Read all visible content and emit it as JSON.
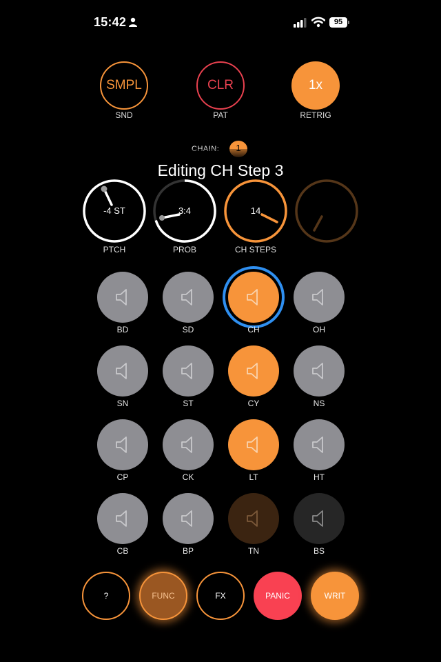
{
  "status_bar": {
    "time": "15:42",
    "battery": "95"
  },
  "top_buttons": [
    {
      "label": "SMPL",
      "caption": "SND"
    },
    {
      "label": "CLR",
      "caption": "PAT"
    },
    {
      "label": "1x",
      "caption": "RETRIG"
    }
  ],
  "chain": {
    "label": "CHAIN:",
    "value": "1"
  },
  "editing_title": "Editing CH Step 3",
  "knobs": [
    {
      "value": "-4 ST",
      "label": "PTCH"
    },
    {
      "value": "3:4",
      "label": "PROB"
    },
    {
      "value": "14",
      "label": "CH STEPS"
    },
    {
      "value": "",
      "label": ""
    }
  ],
  "pads": [
    {
      "label": "BD",
      "state": "gray"
    },
    {
      "label": "SD",
      "state": "gray"
    },
    {
      "label": "CH",
      "state": "orange-selected"
    },
    {
      "label": "OH",
      "state": "gray"
    },
    {
      "label": "SN",
      "state": "gray"
    },
    {
      "label": "ST",
      "state": "gray"
    },
    {
      "label": "CY",
      "state": "orange"
    },
    {
      "label": "NS",
      "state": "gray"
    },
    {
      "label": "CP",
      "state": "gray"
    },
    {
      "label": "CK",
      "state": "gray"
    },
    {
      "label": "LT",
      "state": "orange"
    },
    {
      "label": "HT",
      "state": "gray"
    },
    {
      "label": "CB",
      "state": "gray"
    },
    {
      "label": "BP",
      "state": "gray"
    },
    {
      "label": "TN",
      "state": "dim-orange"
    },
    {
      "label": "BS",
      "state": "dim-gray"
    }
  ],
  "pad_icon": "speaker-icon",
  "bottom_buttons": [
    {
      "label": "?"
    },
    {
      "label": "FUNC"
    },
    {
      "label": "FX"
    },
    {
      "label": "PANIC"
    },
    {
      "label": "WRIT"
    }
  ],
  "colors": {
    "accent_orange": "#f7943a",
    "clear_red": "#e8414f",
    "panic_red": "#f94152",
    "selected_blue": "#2f8ff0",
    "pad_gray": "#8e8e93"
  }
}
